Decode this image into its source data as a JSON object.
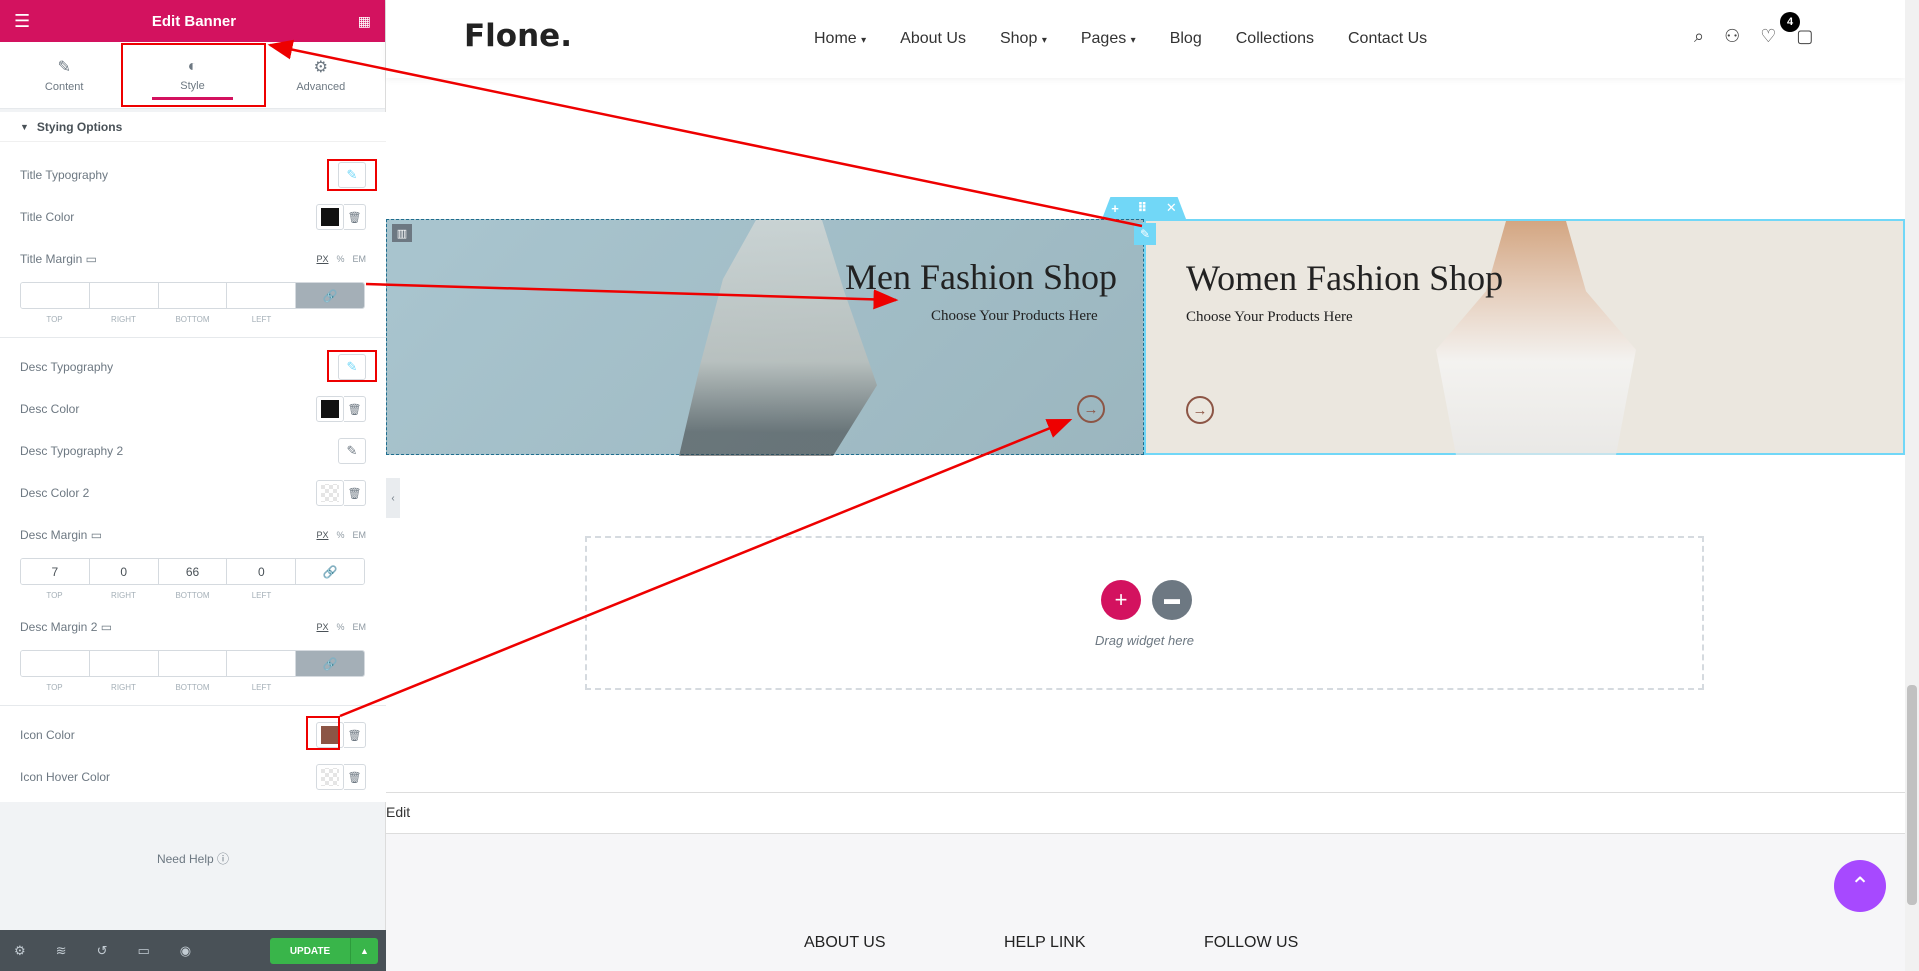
{
  "panel": {
    "title": "Edit Banner",
    "tabs": [
      {
        "label": "Content",
        "icon": "pencil-icon"
      },
      {
        "label": "Style",
        "icon": "contrast-icon"
      },
      {
        "label": "Advanced",
        "icon": "gear-icon"
      }
    ],
    "section": "Stying Options",
    "title_typography": "Title Typography",
    "title_color": "Title Color",
    "title_color_value": "#111111",
    "title_margin": "Title Margin",
    "units": [
      "PX",
      "%",
      "EM"
    ],
    "dim_labels": [
      "TOP",
      "RIGHT",
      "BOTTOM",
      "LEFT"
    ],
    "desc_typography": "Desc Typography",
    "desc_color": "Desc Color",
    "desc_color_value": "#111111",
    "desc_typography2": "Desc Typography 2",
    "desc_color2": "Desc Color 2",
    "desc_margin": "Desc Margin",
    "desc_margin_values": [
      "7",
      "0",
      "66",
      "0"
    ],
    "desc_margin2": "Desc Margin 2",
    "icon_color": "Icon Color",
    "icon_color_value": "#8c5545",
    "icon_hover_color": "Icon Hover Color",
    "need_help": "Need Help",
    "update": "UPDATE"
  },
  "site": {
    "logo": "Flone.",
    "menu": [
      "Home",
      "About Us",
      "Shop",
      "Pages",
      "Blog",
      "Collections",
      "Contact Us"
    ],
    "cart_count": "4",
    "banners": [
      {
        "title": "Men Fashion Shop",
        "subtitle": "Choose Your Products Here"
      },
      {
        "title": "Women Fashion Shop",
        "subtitle": "Choose Your Products Here"
      }
    ],
    "drag_text": "Drag widget here",
    "edit_link": "Edit",
    "footer": [
      "ABOUT US",
      "HELP LINK",
      "FOLLOW US"
    ]
  }
}
